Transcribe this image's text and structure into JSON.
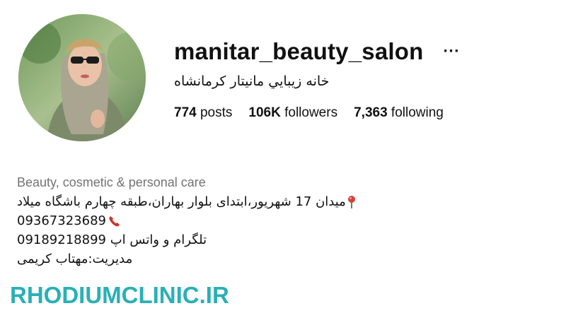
{
  "profile": {
    "username": "manitar_beauty_salon",
    "full_name": "خانه زيبايي مانيتار كرمانشاه",
    "more_label": "···",
    "stats": [
      {
        "value": "774",
        "label": "posts"
      },
      {
        "value": "106K",
        "label": "followers"
      },
      {
        "value": "7,363",
        "label": "following"
      }
    ]
  },
  "bio": {
    "category": "Beauty, cosmetic & personal care",
    "address": "میدان 17 شهریور،ابتدای بلوار بهاران،طبقه چهارم باشگاه میلاد",
    "phone": "09367323689",
    "messengers": "تلگرام و واتس اپ 09189218899",
    "manager": "مدیریت:مهتاب کریمی"
  },
  "icons": {
    "location": "round-pushpin-icon",
    "phone": "telephone-receiver-icon",
    "more": "ellipsis-icon"
  },
  "colors": {
    "category": "#737373",
    "watermark": "#2ab0b6"
  },
  "watermark": "RHODIUMCLINIC.IR"
}
